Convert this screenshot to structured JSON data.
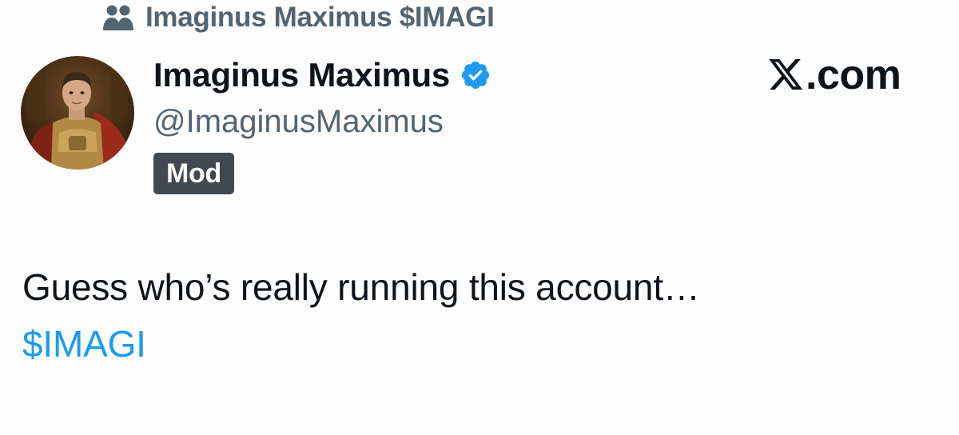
{
  "community": {
    "icon": "community-icon",
    "name": "Imaginus Maximus $IMAGI"
  },
  "author": {
    "avatar": "avatar",
    "display_name": "Imaginus Maximus",
    "verified_icon": "verified-badge-icon",
    "verified_color": "#1d9bf0",
    "handle": "@ImaginusMaximus",
    "role_badge": "Mod"
  },
  "brand": {
    "logo": "x-logo-icon",
    "domain": ".com"
  },
  "post": {
    "text": "Guess who’s really running this account…",
    "cashtag": "$IMAGI",
    "cashtag_color": "#1d9bf0"
  }
}
